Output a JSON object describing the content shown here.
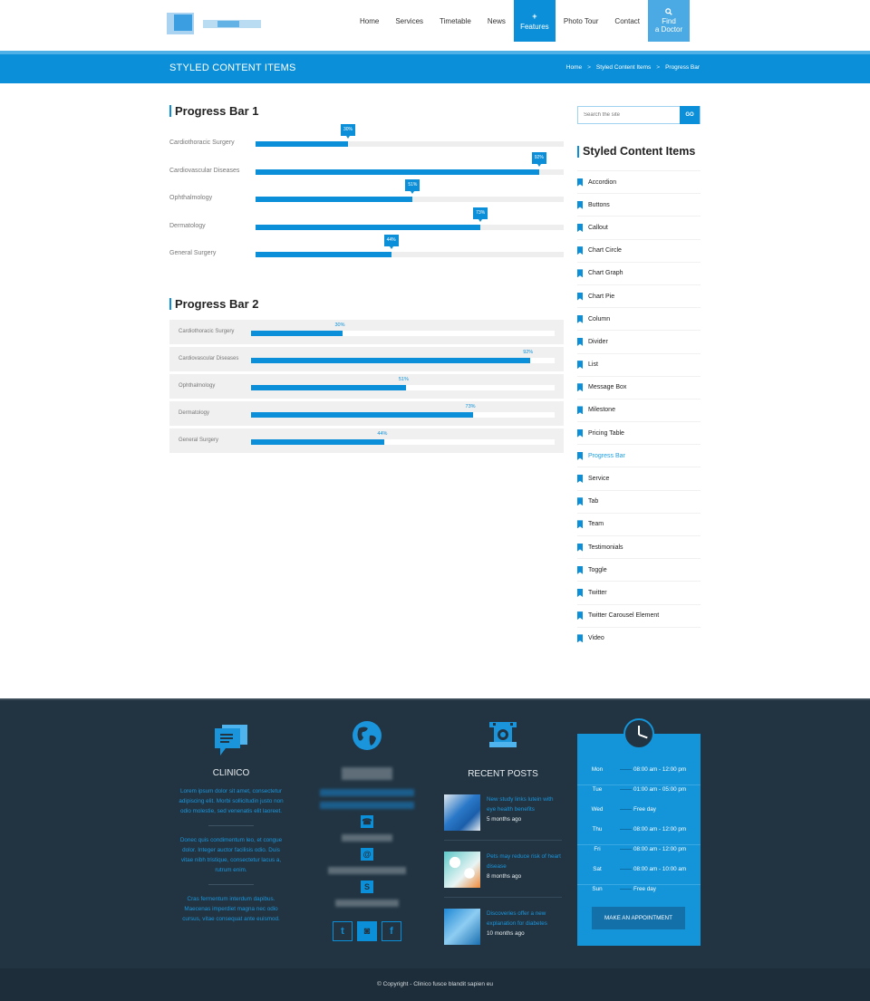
{
  "header": {
    "nav": [
      {
        "label": "Home"
      },
      {
        "label": "Services"
      },
      {
        "label": "Timetable"
      },
      {
        "label": "News"
      },
      {
        "label": "Features",
        "icon": "+",
        "active": true
      },
      {
        "label": "Photo Tour"
      },
      {
        "label": "Contact"
      }
    ],
    "find_doctor": {
      "line1": "Find",
      "line2": "a Doctor",
      "icon": "search-icon"
    }
  },
  "titlebar": {
    "title": "STYLED CONTENT ITEMS",
    "breadcrumb": [
      "Home",
      "Styled Content Items",
      "Progress Bar"
    ],
    "separator": ">"
  },
  "progress_bar_1": {
    "title": "Progress Bar 1",
    "items": [
      {
        "label": "Cardiothoracic Surgery",
        "percent": 30,
        "text": "30%"
      },
      {
        "label": "Cardiovascular Diseases",
        "percent": 92,
        "text": "92%"
      },
      {
        "label": "Ophthalmology",
        "percent": 51,
        "text": "51%"
      },
      {
        "label": "Dermatology",
        "percent": 73,
        "text": "73%"
      },
      {
        "label": "General Surgery",
        "percent": 44,
        "text": "44%"
      }
    ]
  },
  "progress_bar_2": {
    "title": "Progress Bar 2",
    "items": [
      {
        "label": "Cardiothoracic Surgery",
        "percent": 30,
        "text": "30%"
      },
      {
        "label": "Cardiovascular Diseases",
        "percent": 92,
        "text": "92%"
      },
      {
        "label": "Ophthalmology",
        "percent": 51,
        "text": "51%"
      },
      {
        "label": "Dermatology",
        "percent": 73,
        "text": "73%"
      },
      {
        "label": "General Surgery",
        "percent": 44,
        "text": "44%"
      }
    ]
  },
  "sidebar": {
    "search_placeholder": "Search the site",
    "search_button": "GO",
    "title": "Styled Content Items",
    "items": [
      {
        "label": "Accordion"
      },
      {
        "label": "Buttons"
      },
      {
        "label": "Callout"
      },
      {
        "label": "Chart Circle"
      },
      {
        "label": "Chart Graph"
      },
      {
        "label": "Chart Pie"
      },
      {
        "label": "Column"
      },
      {
        "label": "Divider"
      },
      {
        "label": "List"
      },
      {
        "label": "Message Box"
      },
      {
        "label": "Milestone"
      },
      {
        "label": "Pricing Table"
      },
      {
        "label": "Progress Bar",
        "active": true
      },
      {
        "label": "Service"
      },
      {
        "label": "Tab"
      },
      {
        "label": "Team"
      },
      {
        "label": "Testimonials"
      },
      {
        "label": "Toggle"
      },
      {
        "label": "Twitter"
      },
      {
        "label": "Twitter Carousel Element"
      },
      {
        "label": "Video"
      }
    ]
  },
  "footer": {
    "about": {
      "title": "CLINICO",
      "paragraphs": [
        "Lorem ipsum dolor sit amet, consectetur adipiscing elit. Morbi sollicitudin justo non odio molestie, sed venenatis elit laoreet.",
        "Donec quis condimentum leo, et congue dolor. Integer auctor facilisis odio. Duis vitae nibh tristique, consectetur lacus a, rutrum enim.",
        "Cras fermentum interdum dapibus. Maecenas imperdiet magna nec odio cursus, vitae consequat ante euismod."
      ]
    },
    "contact": {
      "social": [
        {
          "name": "twitter",
          "glyph": "t"
        },
        {
          "name": "instagram",
          "glyph": "◙"
        },
        {
          "name": "facebook",
          "glyph": "f"
        }
      ]
    },
    "recent_posts": {
      "title": "RECENT POSTS",
      "posts": [
        {
          "title": "New study links lutein with eye health benefits",
          "time": "5 months ago"
        },
        {
          "title": "Pets may reduce risk of heart disease",
          "time": "8 months ago"
        },
        {
          "title": "Discoveries offer a new explanation for diabetes",
          "time": "10 months ago"
        }
      ]
    },
    "hours": {
      "rows": [
        {
          "day": "Mon",
          "time": "08:00 am - 12:00 pm"
        },
        {
          "day": "Tue",
          "time": "01:00 am - 05:00 pm"
        },
        {
          "day": "Wed",
          "time": "Free day"
        },
        {
          "day": "Thu",
          "time": "08:00 am - 12:00 pm"
        },
        {
          "day": "Fri",
          "time": "08:00 am - 12:00 pm"
        },
        {
          "day": "Sat",
          "time": "08:00 am - 10:00 am"
        },
        {
          "day": "Sun",
          "time": "Free day"
        }
      ],
      "button": "MAKE AN APPOINTMENT"
    },
    "copyright": "© Copyright - Clinico  fusce blandit sapien eu"
  },
  "colors": {
    "accent": "#0b8fd8",
    "footer_bg": "#223442",
    "footer_bottom": "#1d2d39",
    "track": "#eeeeee"
  }
}
